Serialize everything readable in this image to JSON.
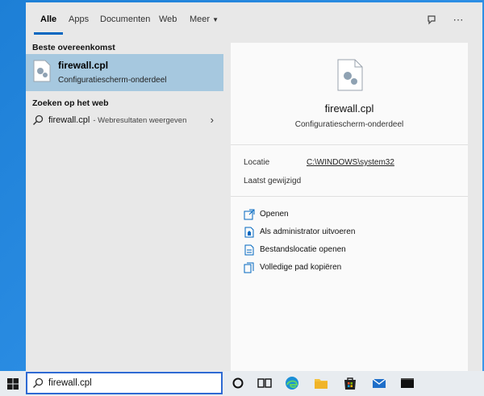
{
  "tabs": [
    {
      "label": "Alle",
      "active": true
    },
    {
      "label": "Apps"
    },
    {
      "label": "Documenten"
    },
    {
      "label": "Web"
    },
    {
      "label": "Meer"
    }
  ],
  "top_icons": [
    "feedback-icon",
    "more-options-icon"
  ],
  "left": {
    "best_match_title": "Beste overeenkomst",
    "best_match": {
      "name": "firewall.cpl",
      "subtitle": "Configuratiescherm-onderdeel"
    },
    "web_title": "Zoeken op het web",
    "web_result": {
      "query": "firewall.cpl",
      "subtitle": "- Webresultaten weergeven"
    }
  },
  "preview": {
    "title": "firewall.cpl",
    "subtitle": "Configuratiescherm-onderdeel",
    "location_label": "Locatie",
    "location_value": "C:\\WINDOWS\\system32",
    "modified_label": "Laatst gewijzigd",
    "actions": [
      {
        "label": "Openen",
        "icon": "open-icon"
      },
      {
        "label": "Als administrator uitvoeren",
        "icon": "run-as-admin-icon"
      },
      {
        "label": "Bestandslocatie openen",
        "icon": "file-location-icon"
      },
      {
        "label": "Volledige pad kopiëren",
        "icon": "copy-path-icon"
      }
    ]
  },
  "taskbar": {
    "search_value": "firewall.cpl",
    "icons": [
      "windows-start-icon",
      "search-icon",
      "cortana-icon",
      "task-view-icon",
      "edge-icon",
      "file-explorer-icon",
      "store-icon",
      "mail-icon",
      "terminal-icon"
    ]
  },
  "colors": {
    "accent": "#0067c0",
    "selection": "#a6c8df",
    "desktop": "#2e90e6"
  }
}
